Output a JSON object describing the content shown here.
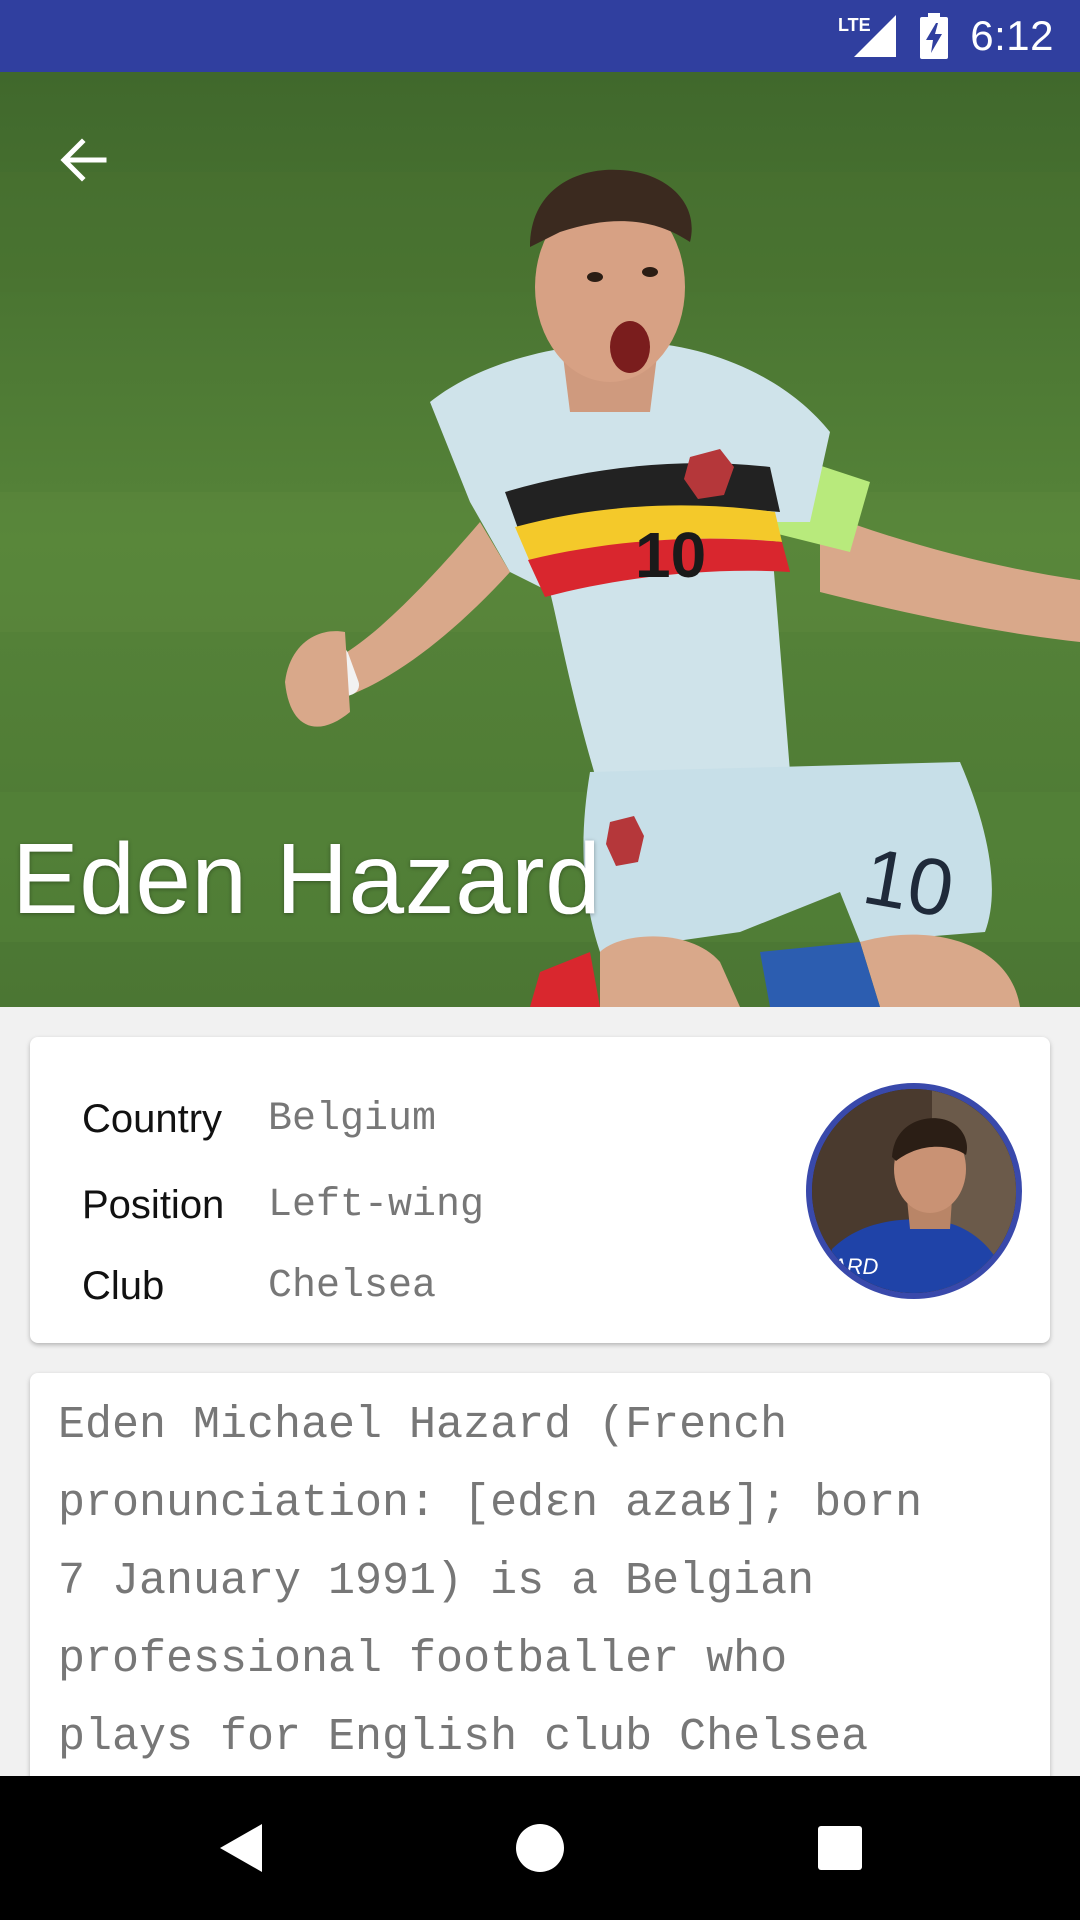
{
  "status_bar": {
    "network": "LTE",
    "time": "6:12"
  },
  "player": {
    "name": "Eden Hazard",
    "details": [
      {
        "label": "Country",
        "value": "Belgium"
      },
      {
        "label": "Position",
        "value": "Left-wing"
      },
      {
        "label": "Club",
        "value": "Chelsea"
      }
    ],
    "bio_lines": [
      "Eden Michael Hazard (French",
      "pronunciation: [edɛn azaʁ]; born",
      "7 January 1991) is a Belgian",
      "professional footballer who",
      "plays for English club Chelsea"
    ],
    "jersey_number": "10"
  },
  "icons": {
    "back": "arrow-back-icon",
    "signal": "signal-icon",
    "battery": "battery-charging-icon",
    "nav_back": "triangle-back-icon",
    "nav_home": "circle-home-icon",
    "nav_recents": "square-recents-icon"
  },
  "colors": {
    "status_bar": "#303f9f",
    "avatar_border": "#3949ab",
    "label_text": "#111111",
    "value_text": "#777777"
  }
}
